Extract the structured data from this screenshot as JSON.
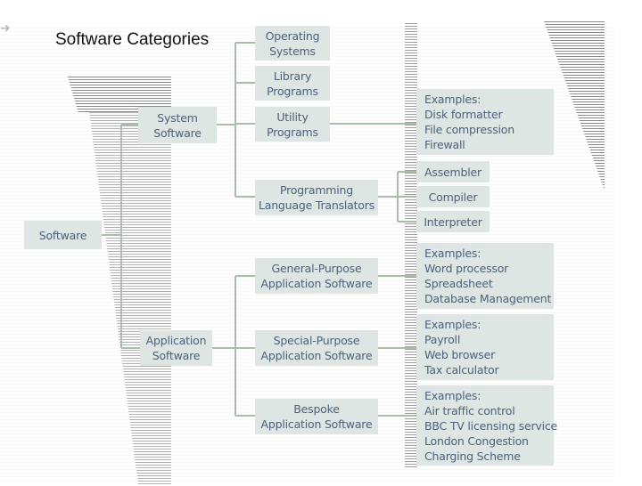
{
  "title": "Software Categories",
  "colors": {
    "node_fill": "#dde6e2",
    "node_text": "#4d607e",
    "connector": "#a8bea8"
  },
  "root": {
    "label": "Software"
  },
  "system": {
    "label": [
      "System",
      "Software"
    ],
    "children": [
      {
        "label": [
          "Operating",
          "Systems"
        ]
      },
      {
        "label": [
          "Library",
          "Programs"
        ]
      },
      {
        "label": [
          "Utility",
          "Programs"
        ]
      },
      {
        "label": [
          "Programming",
          "Language Translators"
        ]
      }
    ],
    "utility_examples": [
      "Examples:",
      "Disk formatter",
      "File compression",
      "Firewall"
    ],
    "translators": [
      "Assembler",
      "Compiler",
      "Interpreter"
    ]
  },
  "application": {
    "label": [
      "Application",
      "Software"
    ],
    "children": [
      {
        "label": [
          "General-Purpose",
          "Application Software"
        ],
        "examples": [
          "Examples:",
          "Word processor",
          "Spreadsheet",
          "Database Management"
        ]
      },
      {
        "label": [
          "Special-Purpose",
          "Application Software"
        ],
        "examples": [
          "Examples:",
          "Payroll",
          "Web browser",
          "Tax calculator"
        ]
      },
      {
        "label": [
          "Bespoke",
          "Application Software"
        ],
        "examples": [
          "Examples:",
          "Air traffic control",
          "BBC TV licensing service",
          "London Congestion",
          "Charging Scheme"
        ]
      }
    ]
  }
}
